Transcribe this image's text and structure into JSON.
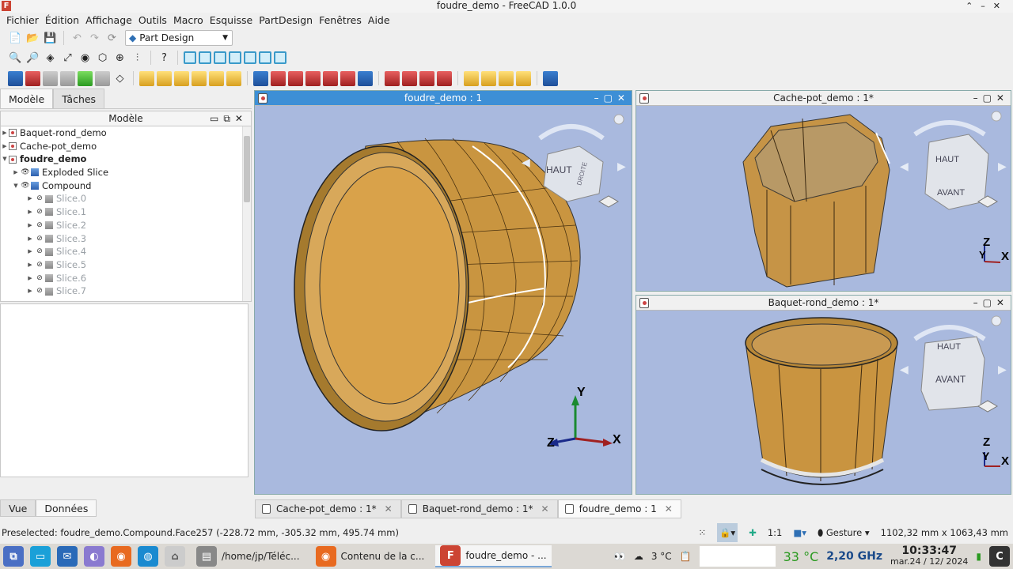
{
  "window": {
    "title": "foudre_demo - FreeCAD 1.0.0",
    "controls": [
      "⌃",
      "–",
      "✕"
    ]
  },
  "menu": [
    "Fichier",
    "Édition",
    "Affichage",
    "Outils",
    "Macro",
    "Esquisse",
    "PartDesign",
    "Fenêtres",
    "Aide"
  ],
  "workbench": {
    "selected": "Part Design"
  },
  "left": {
    "tabs": [
      "Modèle",
      "Tâches"
    ],
    "tree_header": "Modèle",
    "tree": [
      {
        "label": "Baquet-rond_demo",
        "level": 0
      },
      {
        "label": "Cache-pot_demo",
        "level": 0
      },
      {
        "label": "foudre_demo",
        "level": 0
      },
      {
        "label": "Exploded Slice",
        "level": 1
      },
      {
        "label": "Compound",
        "level": 1
      },
      {
        "label": "Slice.0"
      },
      {
        "label": "Slice.1"
      },
      {
        "label": "Slice.2"
      },
      {
        "label": "Slice.3"
      },
      {
        "label": "Slice.4"
      },
      {
        "label": "Slice.5"
      },
      {
        "label": "Slice.6"
      },
      {
        "label": "Slice.7"
      }
    ],
    "bottom_tabs": [
      "Vue",
      "Données"
    ]
  },
  "views": {
    "main": {
      "title": "foudre_demo : 1",
      "nav_label": "HAUT",
      "nav_label2": "DROITE",
      "axes": [
        "Y",
        "Z",
        "X"
      ]
    },
    "cachepot": {
      "title": "Cache-pot_demo : 1*",
      "nav_top": "HAUT",
      "nav_front": "AVANT",
      "axes": [
        "Z",
        "Y",
        "X"
      ]
    },
    "baquet": {
      "title": "Baquet-rond_demo : 1*",
      "nav_top": "HAUT",
      "nav_front": "AVANT",
      "axes": [
        "Z",
        "Y",
        "X"
      ]
    }
  },
  "doc_tabs": [
    {
      "label": "Cache-pot_demo : 1*",
      "active": false
    },
    {
      "label": "Baquet-rond_demo : 1*",
      "active": false
    },
    {
      "label": "foudre_demo : 1",
      "active": true
    }
  ],
  "status": {
    "message": "Preselected: foudre_demo.Compound.Face257 (-228.72 mm, -305.32 mm, 495.74 mm)",
    "scale": "1:1",
    "nav_style": "Gesture",
    "dimensions": "1102,32 mm x 1063,43 mm"
  },
  "taskbar": {
    "items": [
      "/home/jp/Téléc...",
      "Contenu de la c...",
      "foudre_demo - ..."
    ],
    "weather": "3 °C",
    "cpu_temp": "33 °C",
    "cpu_freq": "2,20 GHz",
    "time": "10:33:47",
    "date": "mar.24 / 12/ 2024"
  },
  "colors": {
    "accent": "#3d8fd6",
    "viewport_bg": "#a9b9de",
    "wood": "#d6a24a"
  }
}
